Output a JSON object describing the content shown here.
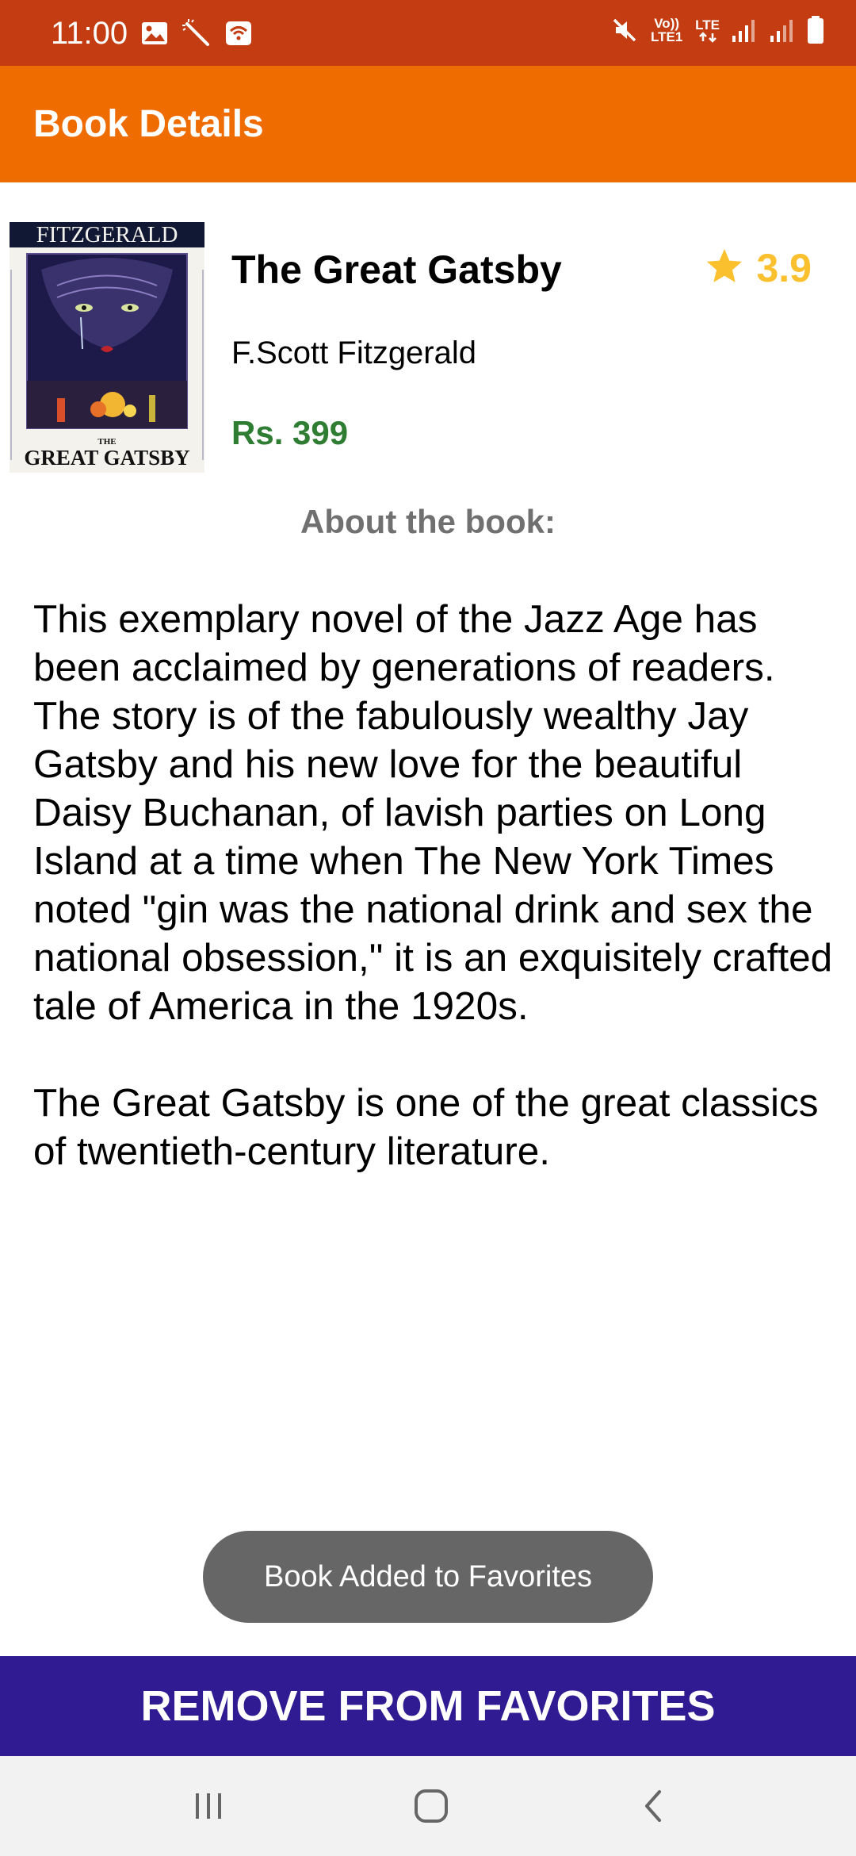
{
  "status_bar": {
    "time": "11:00",
    "left_icons": [
      "image-icon",
      "magic-wand-icon",
      "wifi-calling-icon"
    ],
    "volte_label": "Vo))\nLTE1",
    "lte_label": "LTE",
    "right_icons": [
      "mute-icon",
      "volte-icon",
      "lte-icon",
      "signal-icon",
      "signal-icon",
      "battery-icon"
    ]
  },
  "app_bar": {
    "title": "Book Details"
  },
  "book": {
    "title": "The Great Gatsby",
    "author": "F.Scott Fitzgerald",
    "price": "Rs. 399",
    "rating": "3.9",
    "cover": {
      "top_text": "FITZGERALD",
      "small_text": "THE",
      "bottom_text": "GREAT GATSBY"
    }
  },
  "about": {
    "heading": "About the book:",
    "description": "This exemplary novel of the Jazz Age has been acclaimed by generations of readers. The story is of the fabulously wealthy Jay Gatsby and his new love for the beautiful Daisy Buchanan, of lavish parties on Long Island at a time when The New York Times noted \"gin was the national drink and sex the national obsession,\" it is an exquisitely crafted tale of America in the 1920s.\n\nThe Great Gatsby is one of the great classics of twentieth-century literature."
  },
  "toast": {
    "message": "Book Added to Favorites"
  },
  "actions": {
    "favorite_button": "REMOVE FROM FAVORITES"
  },
  "nav_bar": {
    "buttons": [
      "recent-apps-icon",
      "home-icon",
      "back-icon"
    ]
  },
  "colors": {
    "status_bar": "#c43d12",
    "app_bar": "#ef6c00",
    "price": "#2e7d32",
    "rating": "#fbc02d",
    "button": "#311b92",
    "toast": "#666666"
  }
}
